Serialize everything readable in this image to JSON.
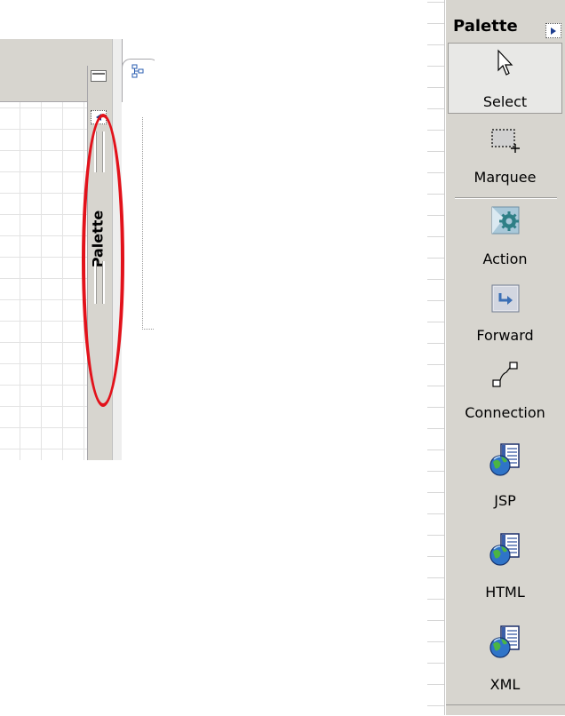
{
  "collapsed_view": {
    "palette_label": "Palette",
    "expand_icon": "triangle-left-icon",
    "maximize_icon": "maximize-icon",
    "outline_icon": "outline-tree-icon"
  },
  "palette": {
    "title": "Palette",
    "collapse_icon": "triangle-right-icon",
    "tools": [
      {
        "label": "Select",
        "icon": "arrow-pointer-icon"
      },
      {
        "label": "Marquee",
        "icon": "marquee-icon"
      },
      {
        "label": "Action",
        "icon": "action-gear-icon"
      },
      {
        "label": "Forward",
        "icon": "forward-arrow-icon"
      },
      {
        "label": "Connection",
        "icon": "connection-icon"
      },
      {
        "label": "JSP",
        "icon": "globe-page-icon"
      },
      {
        "label": "HTML",
        "icon": "globe-page-icon"
      },
      {
        "label": "XML",
        "icon": "globe-page-icon"
      }
    ]
  },
  "colors": {
    "panel": "#d7d5cf",
    "highlight": "#e2121b",
    "button_triangle": "#1d3d8f"
  }
}
